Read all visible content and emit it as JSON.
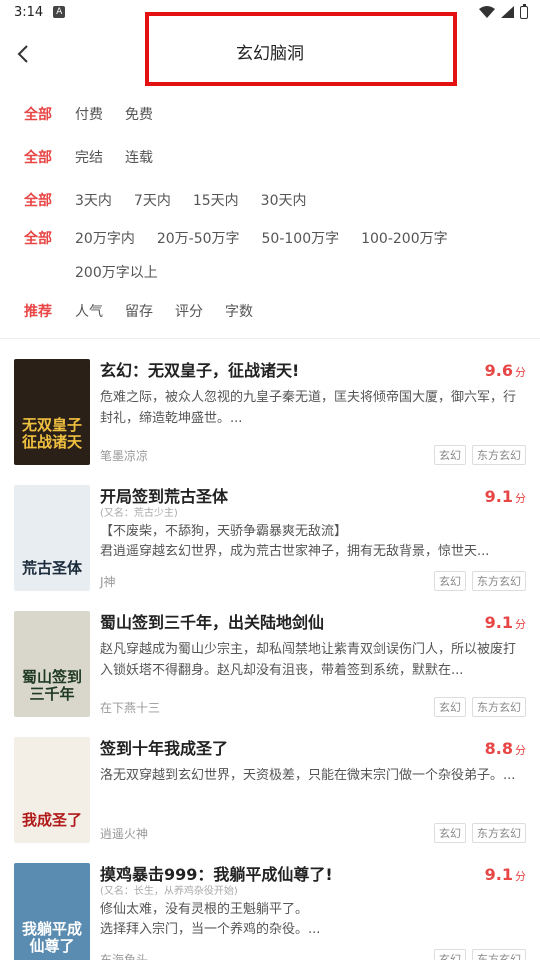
{
  "status_bar": {
    "time": "3:14",
    "notif": "A"
  },
  "header": {
    "title": "玄幻脑洞"
  },
  "filters": {
    "row1": {
      "lead": "全部",
      "options": [
        "付费",
        "免费"
      ]
    },
    "row2": {
      "lead": "全部",
      "options": [
        "完结",
        "连载"
      ]
    },
    "row3": {
      "lead": "全部",
      "options": [
        "3天内",
        "7天内",
        "15天内",
        "30天内"
      ]
    },
    "row4": {
      "lead": "全部",
      "options": [
        "20万字内",
        "20万-50万字",
        "50-100万字",
        "100-200万字",
        "200万字以上"
      ]
    },
    "row5": {
      "lead": "推荐",
      "options": [
        "人气",
        "留存",
        "评分",
        "字数"
      ]
    }
  },
  "books": [
    {
      "title": "玄幻：无双皇子，征战诸天!",
      "alias": "",
      "desc": "危难之际，被众人忽视的九皇子秦无道，匡夫将倾帝国大厦，御六军，行封礼，缔造乾坤盛世。...",
      "score": "9.6",
      "score_unit": "分",
      "author": "笔墨凉凉",
      "tags": [
        "玄幻",
        "东方玄幻"
      ],
      "cover_text": "无双皇子\n征战诸天",
      "cover_bg": "#2a2018",
      "cover_fg": "#f0c040"
    },
    {
      "title": "开局签到荒古圣体",
      "alias": "(又名：荒古少主)",
      "desc": "【不废柴，不舔狗，天骄争霸暴爽无敌流】\n君逍遥穿越玄幻世界，成为荒古世家神子，拥有无敌背景，惊世天...",
      "score": "9.1",
      "score_unit": "分",
      "author": "J神",
      "tags": [
        "玄幻",
        "东方玄幻"
      ],
      "cover_text": "荒古圣体",
      "cover_bg": "#e8edf2",
      "cover_fg": "#1a2a3a"
    },
    {
      "title": "蜀山签到三千年，出关陆地剑仙",
      "alias": "",
      "desc": "赵凡穿越成为蜀山少宗主，却私闯禁地让紫青双剑误伤门人，所以被废打入锁妖塔不得翻身。赵凡却没有沮丧，带着签到系统，默默在...",
      "score": "9.1",
      "score_unit": "分",
      "author": "在下燕十三",
      "tags": [
        "玄幻",
        "东方玄幻"
      ],
      "cover_text": "蜀山签到\n三千年",
      "cover_bg": "#d9d6cc",
      "cover_fg": "#1f3a22"
    },
    {
      "title": "签到十年我成圣了",
      "alias": "",
      "desc": "洛无双穿越到玄幻世界，天资极差，只能在微末宗门做一个杂役弟子。...",
      "score": "8.8",
      "score_unit": "分",
      "author": "逍遥火神",
      "tags": [
        "玄幻",
        "东方玄幻"
      ],
      "cover_text": "我成圣了",
      "cover_bg": "#f4efe6",
      "cover_fg": "#b01a1a"
    },
    {
      "title": "摸鸡暴击999：我躺平成仙尊了!",
      "alias": "(又名：长生，从养鸡杂役开始)",
      "desc": "修仙太难，没有灵根的王魁躺平了。\n选择拜入宗门，当一个养鸡的杂役。...",
      "score": "9.1",
      "score_unit": "分",
      "author": "东海鱼头",
      "tags": [
        "玄幻",
        "东方玄幻"
      ],
      "cover_text": "我躺平成\n仙尊了",
      "cover_bg": "#5a8bb0",
      "cover_fg": "#ffffff"
    }
  ]
}
